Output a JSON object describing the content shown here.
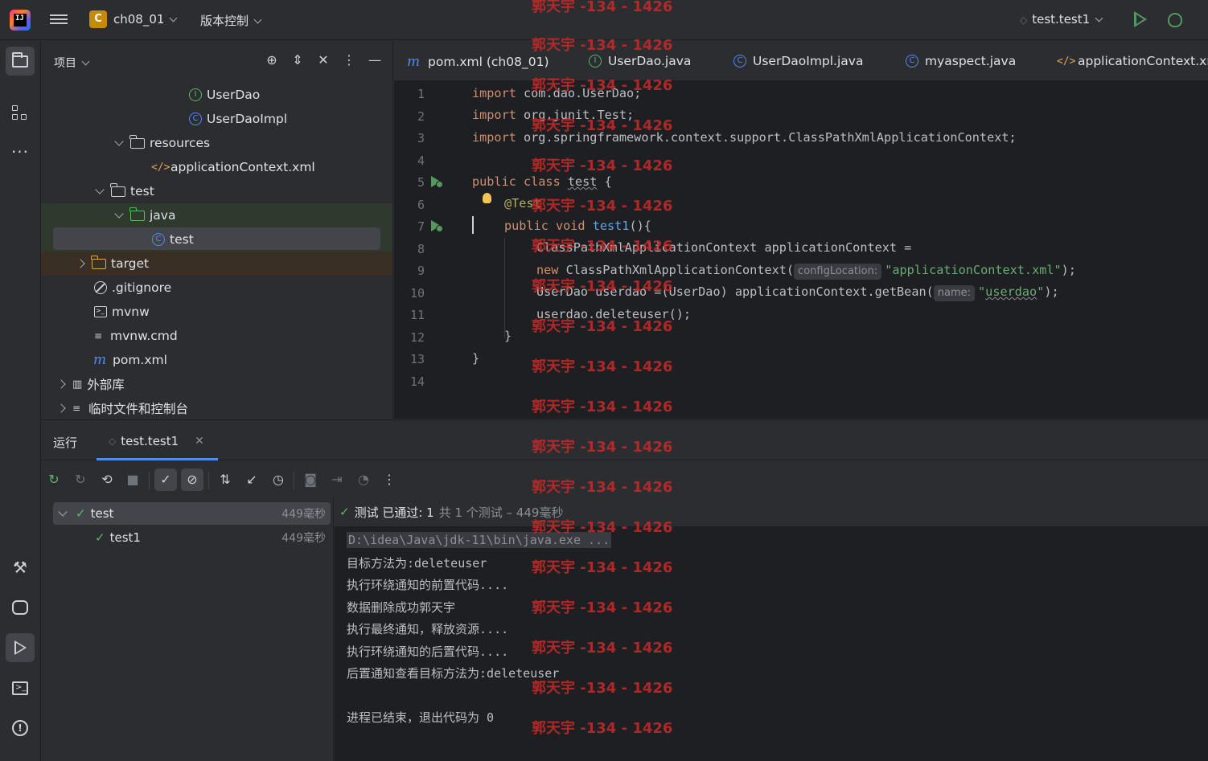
{
  "titlebar": {
    "project_badge": "C",
    "project_name": "ch08_01",
    "vcs_label": "版本控制",
    "run_config": "test.test1"
  },
  "project_panel": {
    "title": "项目",
    "items": [
      {
        "label": "UserDao",
        "icon": "interface-icon"
      },
      {
        "label": "UserDaoImpl",
        "icon": "class-icon"
      },
      {
        "label": "resources",
        "icon": "resources-folder-icon"
      },
      {
        "label": "applicationContext.xml",
        "icon": "xml-file-icon"
      },
      {
        "label": "test",
        "icon": "folder-icon"
      },
      {
        "label": "java",
        "icon": "test-source-folder-icon"
      },
      {
        "label": "test",
        "icon": "class-icon"
      },
      {
        "label": "target",
        "icon": "excluded-folder-icon"
      },
      {
        "label": ".gitignore",
        "icon": "ignore-file-icon"
      },
      {
        "label": "mvnw",
        "icon": "script-icon"
      },
      {
        "label": "mvnw.cmd",
        "icon": "text-file-icon"
      },
      {
        "label": "pom.xml",
        "icon": "maven-icon"
      },
      {
        "label": "外部库",
        "icon": "library-icon"
      },
      {
        "label": "临时文件和控制台",
        "icon": "scratch-icon"
      }
    ]
  },
  "editor": {
    "tabs": [
      {
        "label": "pom.xml (ch08_01)",
        "icon": "maven-icon"
      },
      {
        "label": "UserDao.java",
        "icon": "interface-icon"
      },
      {
        "label": "UserDaoImpl.java",
        "icon": "class-icon"
      },
      {
        "label": "myaspect.java",
        "icon": "class-icon"
      },
      {
        "label": "applicationContext.xml",
        "icon": "xml-file-icon"
      }
    ],
    "line_numbers": [
      "1",
      "2",
      "3",
      "4",
      "5",
      "6",
      "7",
      "8",
      "9",
      "10",
      "11",
      "12",
      "13",
      "14"
    ],
    "code": {
      "l1_kw": "import",
      "l1_rest": " com.dao.UserDao;",
      "l2_kw": "import",
      "l2_rest": " org.junit.Test;",
      "l3_kw": "import",
      "l3_rest": " org.springframework.context.support.ClassPathXmlApplicationContext;",
      "l5_kw": "public class ",
      "l5_name": "test",
      "l5_rest": " {",
      "l6_ann": "@Test",
      "l7_kw": "public void ",
      "l7_fn": "test1",
      "l7_rest": "(){",
      "l8": "ClassPathXmlApplicationContext applicationContext =",
      "l9_kw": "new",
      "l9_mid": " ClassPathXmlApplicationContext(",
      "l9_hint": "configLocation:",
      "l9_str": "\"applicationContext.xml\"",
      "l9_end": ");",
      "l10_a": "UserDao userdao =(UserDao) applicationContext.getBean(",
      "l10_hint": "name:",
      "l10_q1": "\"",
      "l10_str": "userdao",
      "l10_q2": "\"",
      "l10_end": ");",
      "l11": "userdao.deleteuser();",
      "l12": "}",
      "l13": "}"
    }
  },
  "run_panel": {
    "label": "运行",
    "tab": "test.test1",
    "tests": [
      {
        "name": "test",
        "duration": "449毫秒"
      },
      {
        "name": "test1",
        "duration": "449毫秒"
      }
    ],
    "summary_status": "测试 已通过: 1",
    "summary_rest": "共 1 个测试 – 449毫秒",
    "console": [
      "D:\\idea\\Java\\jdk-11\\bin\\java.exe ...",
      "目标方法为:deleteuser",
      "执行环绕通知的前置代码....",
      "数据删除成功郭天宇",
      "执行最终通知，释放资源....",
      "执行环绕通知的后置代码....",
      "后置通知查看目标方法为:deleteuser",
      "",
      "进程已结束，退出代码为 0"
    ]
  },
  "watermark": "郭天宇 -134 - 1426",
  "colors": {
    "accent": "#548af7",
    "success": "#5fb865",
    "watermark": "#c92a2a"
  }
}
